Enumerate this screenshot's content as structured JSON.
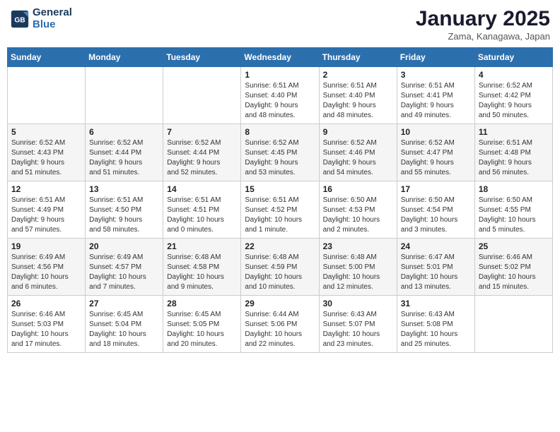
{
  "header": {
    "logo_line1": "General",
    "logo_line2": "Blue",
    "month": "January 2025",
    "location": "Zama, Kanagawa, Japan"
  },
  "weekdays": [
    "Sunday",
    "Monday",
    "Tuesday",
    "Wednesday",
    "Thursday",
    "Friday",
    "Saturday"
  ],
  "weeks": [
    [
      {
        "day": "",
        "info": ""
      },
      {
        "day": "",
        "info": ""
      },
      {
        "day": "",
        "info": ""
      },
      {
        "day": "1",
        "info": "Sunrise: 6:51 AM\nSunset: 4:40 PM\nDaylight: 9 hours\nand 48 minutes."
      },
      {
        "day": "2",
        "info": "Sunrise: 6:51 AM\nSunset: 4:40 PM\nDaylight: 9 hours\nand 48 minutes."
      },
      {
        "day": "3",
        "info": "Sunrise: 6:51 AM\nSunset: 4:41 PM\nDaylight: 9 hours\nand 49 minutes."
      },
      {
        "day": "4",
        "info": "Sunrise: 6:52 AM\nSunset: 4:42 PM\nDaylight: 9 hours\nand 50 minutes."
      }
    ],
    [
      {
        "day": "5",
        "info": "Sunrise: 6:52 AM\nSunset: 4:43 PM\nDaylight: 9 hours\nand 51 minutes."
      },
      {
        "day": "6",
        "info": "Sunrise: 6:52 AM\nSunset: 4:44 PM\nDaylight: 9 hours\nand 51 minutes."
      },
      {
        "day": "7",
        "info": "Sunrise: 6:52 AM\nSunset: 4:44 PM\nDaylight: 9 hours\nand 52 minutes."
      },
      {
        "day": "8",
        "info": "Sunrise: 6:52 AM\nSunset: 4:45 PM\nDaylight: 9 hours\nand 53 minutes."
      },
      {
        "day": "9",
        "info": "Sunrise: 6:52 AM\nSunset: 4:46 PM\nDaylight: 9 hours\nand 54 minutes."
      },
      {
        "day": "10",
        "info": "Sunrise: 6:52 AM\nSunset: 4:47 PM\nDaylight: 9 hours\nand 55 minutes."
      },
      {
        "day": "11",
        "info": "Sunrise: 6:51 AM\nSunset: 4:48 PM\nDaylight: 9 hours\nand 56 minutes."
      }
    ],
    [
      {
        "day": "12",
        "info": "Sunrise: 6:51 AM\nSunset: 4:49 PM\nDaylight: 9 hours\nand 57 minutes."
      },
      {
        "day": "13",
        "info": "Sunrise: 6:51 AM\nSunset: 4:50 PM\nDaylight: 9 hours\nand 58 minutes."
      },
      {
        "day": "14",
        "info": "Sunrise: 6:51 AM\nSunset: 4:51 PM\nDaylight: 10 hours\nand 0 minutes."
      },
      {
        "day": "15",
        "info": "Sunrise: 6:51 AM\nSunset: 4:52 PM\nDaylight: 10 hours\nand 1 minute."
      },
      {
        "day": "16",
        "info": "Sunrise: 6:50 AM\nSunset: 4:53 PM\nDaylight: 10 hours\nand 2 minutes."
      },
      {
        "day": "17",
        "info": "Sunrise: 6:50 AM\nSunset: 4:54 PM\nDaylight: 10 hours\nand 3 minutes."
      },
      {
        "day": "18",
        "info": "Sunrise: 6:50 AM\nSunset: 4:55 PM\nDaylight: 10 hours\nand 5 minutes."
      }
    ],
    [
      {
        "day": "19",
        "info": "Sunrise: 6:49 AM\nSunset: 4:56 PM\nDaylight: 10 hours\nand 6 minutes."
      },
      {
        "day": "20",
        "info": "Sunrise: 6:49 AM\nSunset: 4:57 PM\nDaylight: 10 hours\nand 7 minutes."
      },
      {
        "day": "21",
        "info": "Sunrise: 6:48 AM\nSunset: 4:58 PM\nDaylight: 10 hours\nand 9 minutes."
      },
      {
        "day": "22",
        "info": "Sunrise: 6:48 AM\nSunset: 4:59 PM\nDaylight: 10 hours\nand 10 minutes."
      },
      {
        "day": "23",
        "info": "Sunrise: 6:48 AM\nSunset: 5:00 PM\nDaylight: 10 hours\nand 12 minutes."
      },
      {
        "day": "24",
        "info": "Sunrise: 6:47 AM\nSunset: 5:01 PM\nDaylight: 10 hours\nand 13 minutes."
      },
      {
        "day": "25",
        "info": "Sunrise: 6:46 AM\nSunset: 5:02 PM\nDaylight: 10 hours\nand 15 minutes."
      }
    ],
    [
      {
        "day": "26",
        "info": "Sunrise: 6:46 AM\nSunset: 5:03 PM\nDaylight: 10 hours\nand 17 minutes."
      },
      {
        "day": "27",
        "info": "Sunrise: 6:45 AM\nSunset: 5:04 PM\nDaylight: 10 hours\nand 18 minutes."
      },
      {
        "day": "28",
        "info": "Sunrise: 6:45 AM\nSunset: 5:05 PM\nDaylight: 10 hours\nand 20 minutes."
      },
      {
        "day": "29",
        "info": "Sunrise: 6:44 AM\nSunset: 5:06 PM\nDaylight: 10 hours\nand 22 minutes."
      },
      {
        "day": "30",
        "info": "Sunrise: 6:43 AM\nSunset: 5:07 PM\nDaylight: 10 hours\nand 23 minutes."
      },
      {
        "day": "31",
        "info": "Sunrise: 6:43 AM\nSunset: 5:08 PM\nDaylight: 10 hours\nand 25 minutes."
      },
      {
        "day": "",
        "info": ""
      }
    ]
  ]
}
